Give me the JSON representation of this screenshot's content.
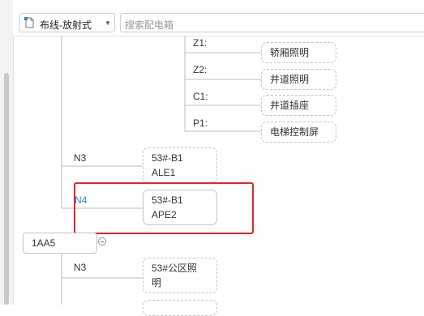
{
  "toolbar": {
    "layout_select": {
      "value": "布线-放射式",
      "icon": "document-layout-icon"
    },
    "search": {
      "placeholder": "搜索配电箱"
    }
  },
  "tree": {
    "z1": {
      "label": "Z1:",
      "node": "轿厢照明"
    },
    "z2": {
      "label": "Z2:",
      "node": "井道照明"
    },
    "c1": {
      "label": "C1:",
      "node": "井道插座"
    },
    "p1": {
      "label": "P1:",
      "node": "电梯控制屏"
    },
    "n3": {
      "label": "N3",
      "node_line1": "53#-B1",
      "node_line2": "ALE1"
    },
    "n4": {
      "label": "N4",
      "node_line1": "53#-B1",
      "node_line2": "APE2",
      "color": "#2a8ad8"
    },
    "root_1aa5": {
      "node": "1AA5"
    },
    "n3b": {
      "label": "N3",
      "node_line1": "53#公区照",
      "node_line2": "明"
    }
  },
  "colors": {
    "highlight": "#e0262a",
    "accent": "#2a8ad8"
  }
}
